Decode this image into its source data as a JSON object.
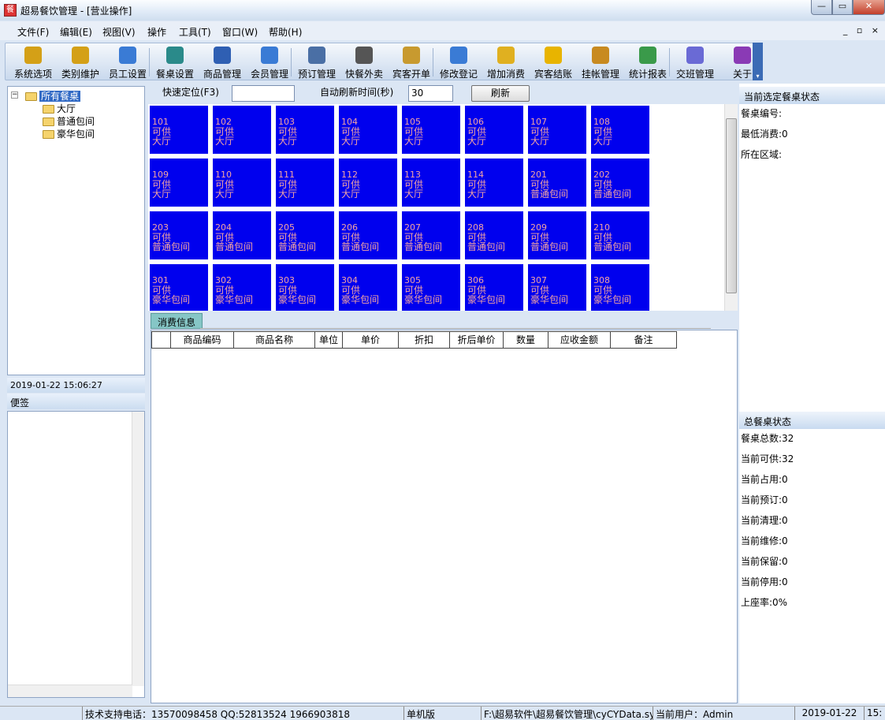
{
  "window": {
    "title": "超易餐饮管理 - [营业操作]",
    "app_icon": "app-logo-icon"
  },
  "menu": [
    "文件(F)",
    "编辑(E)",
    "视图(V)",
    "操作",
    "工具(T)",
    "窗口(W)",
    "帮助(H)"
  ],
  "toolbar": [
    {
      "label": "系统选项",
      "icon": "key-icon",
      "color": "#d4a017"
    },
    {
      "label": "类别维护",
      "icon": "key-icon",
      "color": "#d4a017"
    },
    {
      "label": "员工设置",
      "icon": "person-icon",
      "color": "#3a7bd5"
    },
    {
      "label": "餐桌设置",
      "icon": "table-setup-icon",
      "color": "#2a8a8a"
    },
    {
      "label": "商品管理",
      "icon": "product-icon",
      "color": "#2f5fb3"
    },
    {
      "label": "会员管理",
      "icon": "member-icon",
      "color": "#3a7bd5"
    },
    {
      "label": "预订管理",
      "icon": "phone-icon",
      "color": "#4a6fa5"
    },
    {
      "label": "快餐外卖",
      "icon": "mobile-phone-icon",
      "color": "#555555"
    },
    {
      "label": "宾客开单",
      "icon": "box-icon",
      "color": "#c89a2f"
    },
    {
      "label": "修改登记",
      "icon": "edit-person-icon",
      "color": "#3a7bd5"
    },
    {
      "label": "增加消费",
      "icon": "add-icon",
      "color": "#e0b020"
    },
    {
      "label": "宾客结账",
      "icon": "coin-icon",
      "color": "#e8b400"
    },
    {
      "label": "挂帐管理",
      "icon": "money-bag-icon",
      "color": "#c88a20"
    },
    {
      "label": "统计报表",
      "icon": "bar-chart-icon",
      "color": "#3a9a4a"
    },
    {
      "label": "交班管理",
      "icon": "shift-people-icon",
      "color": "#6a6ad5"
    },
    {
      "label": "关于",
      "icon": "question-icon",
      "color": "#8a3ab5"
    }
  ],
  "tree": {
    "root": "所有餐桌",
    "children": [
      "大厅",
      "普通包间",
      "豪华包间"
    ]
  },
  "datetime": "2019-01-22 15:06:27",
  "notes": {
    "header": "便签"
  },
  "controls": {
    "quick_locate_label": "快速定位(F3)",
    "quick_locate_value": "",
    "auto_refresh_label": "自动刷新时间(秒)",
    "auto_refresh_value": "30",
    "refresh_button": "刷新"
  },
  "tables": [
    {
      "no": "101",
      "status": "可供",
      "area": "大厅"
    },
    {
      "no": "102",
      "status": "可供",
      "area": "大厅"
    },
    {
      "no": "103",
      "status": "可供",
      "area": "大厅"
    },
    {
      "no": "104",
      "status": "可供",
      "area": "大厅"
    },
    {
      "no": "105",
      "status": "可供",
      "area": "大厅"
    },
    {
      "no": "106",
      "status": "可供",
      "area": "大厅"
    },
    {
      "no": "107",
      "status": "可供",
      "area": "大厅"
    },
    {
      "no": "108",
      "status": "可供",
      "area": "大厅"
    },
    {
      "no": "109",
      "status": "可供",
      "area": "大厅"
    },
    {
      "no": "110",
      "status": "可供",
      "area": "大厅"
    },
    {
      "no": "111",
      "status": "可供",
      "area": "大厅"
    },
    {
      "no": "112",
      "status": "可供",
      "area": "大厅"
    },
    {
      "no": "113",
      "status": "可供",
      "area": "大厅"
    },
    {
      "no": "114",
      "status": "可供",
      "area": "大厅"
    },
    {
      "no": "201",
      "status": "可供",
      "area": "普通包间"
    },
    {
      "no": "202",
      "status": "可供",
      "area": "普通包间"
    },
    {
      "no": "203",
      "status": "可供",
      "area": "普通包间"
    },
    {
      "no": "204",
      "status": "可供",
      "area": "普通包间"
    },
    {
      "no": "205",
      "status": "可供",
      "area": "普通包间"
    },
    {
      "no": "206",
      "status": "可供",
      "area": "普通包间"
    },
    {
      "no": "207",
      "status": "可供",
      "area": "普通包间"
    },
    {
      "no": "208",
      "status": "可供",
      "area": "普通包间"
    },
    {
      "no": "209",
      "status": "可供",
      "area": "普通包间"
    },
    {
      "no": "210",
      "status": "可供",
      "area": "普通包间"
    },
    {
      "no": "301",
      "status": "可供",
      "area": "豪华包间"
    },
    {
      "no": "302",
      "status": "可供",
      "area": "豪华包间"
    },
    {
      "no": "303",
      "status": "可供",
      "area": "豪华包间"
    },
    {
      "no": "304",
      "status": "可供",
      "area": "豪华包间"
    },
    {
      "no": "305",
      "status": "可供",
      "area": "豪华包间"
    },
    {
      "no": "306",
      "status": "可供",
      "area": "豪华包间"
    },
    {
      "no": "307",
      "status": "可供",
      "area": "豪华包间"
    },
    {
      "no": "308",
      "status": "可供",
      "area": "豪华包间"
    }
  ],
  "table_colors": {
    "fill": "#0000ee",
    "text": "#f2a3a3"
  },
  "consume_tab": "消费信息",
  "grid_columns": [
    "",
    "商品编码",
    "商品名称",
    "单位",
    "单价",
    "折扣",
    "折后单价",
    "数量",
    "应收金额",
    "备注"
  ],
  "selected_status": {
    "header": "当前选定餐桌状态",
    "lines": [
      "餐桌编号:",
      "最低消费:0",
      "所在区域:"
    ]
  },
  "total_status": {
    "header": "总餐桌状态",
    "lines": [
      "餐桌总数:32",
      "当前可供:32",
      "当前占用:0",
      "当前预订:0",
      "当前清理:0",
      "当前维修:0",
      "当前保留:0",
      "当前停用:0",
      "上座率:0%"
    ]
  },
  "statusbar": [
    "技术支持电话：13570098458 QQ:52813524 1966903818",
    "单机版",
    "F:\\超易软件\\超易餐饮管理\\cyCYData.sys",
    "当前用户：Admin",
    "2019-01-22",
    "15:"
  ]
}
